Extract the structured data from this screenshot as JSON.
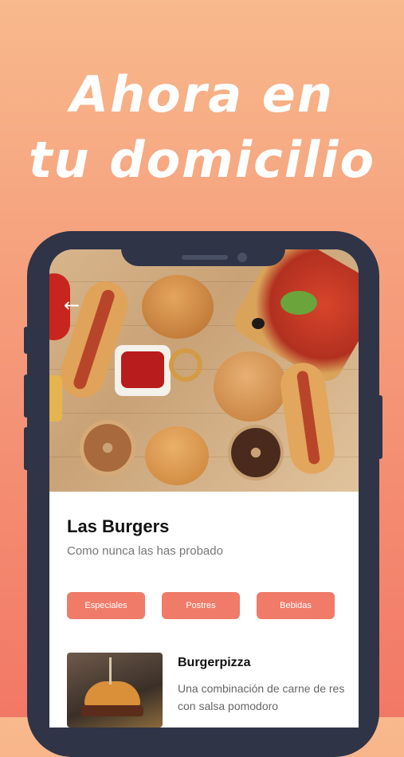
{
  "promo": {
    "headline_line1": "Ahora en",
    "headline_line2": "tu domicilio"
  },
  "restaurant": {
    "name": "Las Burgers",
    "tagline": "Como nunca las has probado"
  },
  "categories": [
    {
      "label": "Especiales"
    },
    {
      "label": "Postres"
    },
    {
      "label": "Bebidas"
    }
  ],
  "menu_items": [
    {
      "name": "Burgerpizza",
      "description": "Una combinación de carne de res con salsa pomodoro"
    }
  ],
  "colors": {
    "accent": "#f07b68",
    "phone_frame": "#2f3447",
    "background_top": "#f8b98c",
    "background_bottom": "#f27866"
  },
  "icons": {
    "back": "back-arrow-icon"
  }
}
